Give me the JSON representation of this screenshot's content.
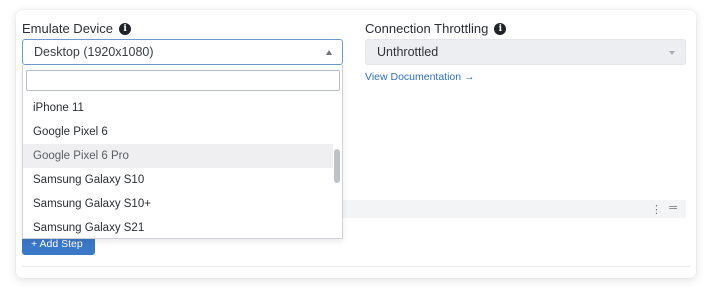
{
  "device": {
    "label": "Emulate Device",
    "selected": "Desktop (1920x1080)",
    "search_placeholder": "",
    "options": [
      "iPhone 11",
      "Google Pixel 6",
      "Google Pixel 6 Pro",
      "Samsung Galaxy S10",
      "Samsung Galaxy S10+",
      "Samsung Galaxy S21"
    ],
    "highlighted": "Google Pixel 6 Pro"
  },
  "throttling": {
    "label": "Connection Throttling",
    "selected": "Unthrottled",
    "link": "View Documentation →"
  },
  "steps": {
    "add_label": "+ Add Step",
    "kebab_glyph": "⋮",
    "drag_glyph": "═"
  },
  "icons": {
    "info_glyph": "i"
  },
  "colors": {
    "accent": "#3b78c8",
    "link": "#2e6fc0",
    "focus_border": "#6c9bd2",
    "highlight_bg": "#efeff1"
  }
}
